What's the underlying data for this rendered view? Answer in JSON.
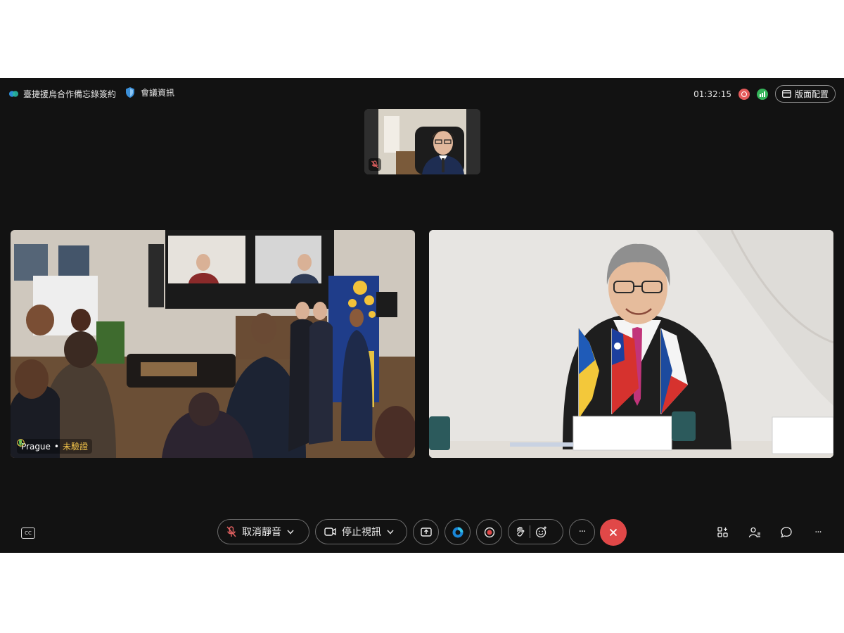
{
  "meeting": {
    "title": "臺捷援烏合作備忘錄簽約",
    "info_label": "會議資訊"
  },
  "status": {
    "timer": "01:32:15",
    "layout_label": "版面配置"
  },
  "tiles": [
    {
      "location": "Prague",
      "verify_status": "未驗證"
    }
  ],
  "controls": {
    "unmute_label": "取消靜音",
    "stop_video_label": "停止視訊",
    "more_symbol": "···",
    "end_color": "#e04848"
  },
  "right_controls": {
    "more_symbol": "···"
  },
  "icons": [
    "closed-caption-icon",
    "muted-mic-icon",
    "video-camera-icon",
    "share-screen-icon",
    "assistant-icon",
    "record-icon",
    "raise-hand-icon",
    "reaction-icon",
    "more-icon",
    "end-call-icon",
    "apps-icon",
    "participants-icon",
    "chat-icon"
  ]
}
